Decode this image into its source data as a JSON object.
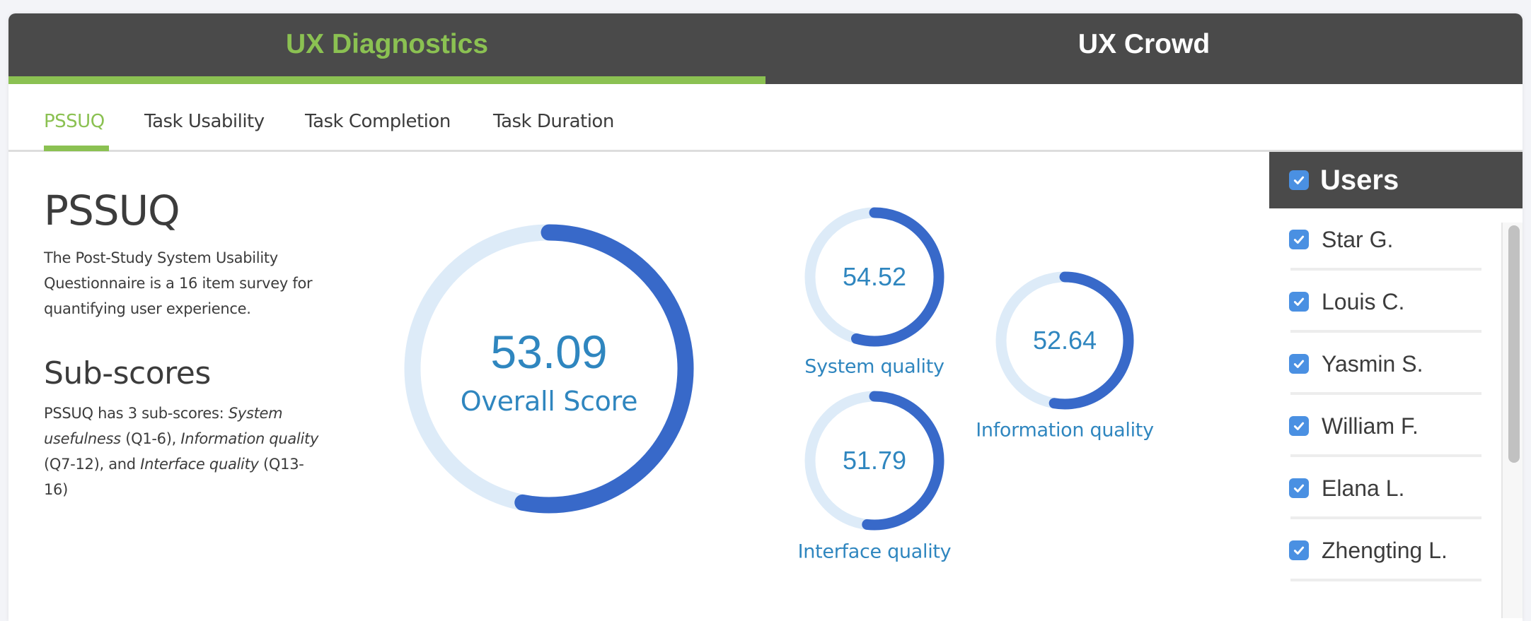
{
  "top_tabs": [
    {
      "label": "UX Diagnostics",
      "active": true
    },
    {
      "label": "UX Crowd",
      "active": false
    }
  ],
  "sub_tabs": [
    {
      "label": "PSSUQ",
      "active": true
    },
    {
      "label": "Task Usability",
      "active": false
    },
    {
      "label": "Task Completion",
      "active": false
    },
    {
      "label": "Task Duration",
      "active": false
    }
  ],
  "description": {
    "title": "PSSUQ",
    "intro": "The Post-Study System Usability Questionnaire is a 16 item survey for quantifying user experience.",
    "subtitle": "Sub-scores",
    "subscores_text": {
      "prefix": "PSSUQ has 3 sub-scores: ",
      "s1": "System usefulness",
      "s1_range": " (Q1-6), ",
      "s2": "Information quality",
      "s2_range": " (Q7-12), and ",
      "s3": "Interface quality",
      "s3_range": " (Q13-16)"
    }
  },
  "scores": {
    "overall": {
      "value": "53.09",
      "label": "Overall Score",
      "percent": 53.09
    },
    "system": {
      "value": "54.52",
      "label": "System quality",
      "percent": 54.52
    },
    "information": {
      "value": "52.64",
      "label": "Information quality",
      "percent": 52.64
    },
    "interface": {
      "value": "51.79",
      "label": "Interface quality",
      "percent": 51.79
    }
  },
  "colors": {
    "accent_green": "#8bc152",
    "ring_fill": "#3869c9",
    "ring_track": "#ddebf8",
    "score_text": "#2f86bf",
    "header_bg": "#4a4a4a",
    "checkbox": "#4a90e2"
  },
  "sidebar": {
    "title": "Users",
    "all_checked": true,
    "users": [
      {
        "name": "Star G.",
        "checked": true
      },
      {
        "name": "Louis C.",
        "checked": true
      },
      {
        "name": "Yasmin S.",
        "checked": true
      },
      {
        "name": "William F.",
        "checked": true
      },
      {
        "name": "Elana L.",
        "checked": true
      },
      {
        "name": "Zhengting L.",
        "checked": true
      }
    ]
  }
}
